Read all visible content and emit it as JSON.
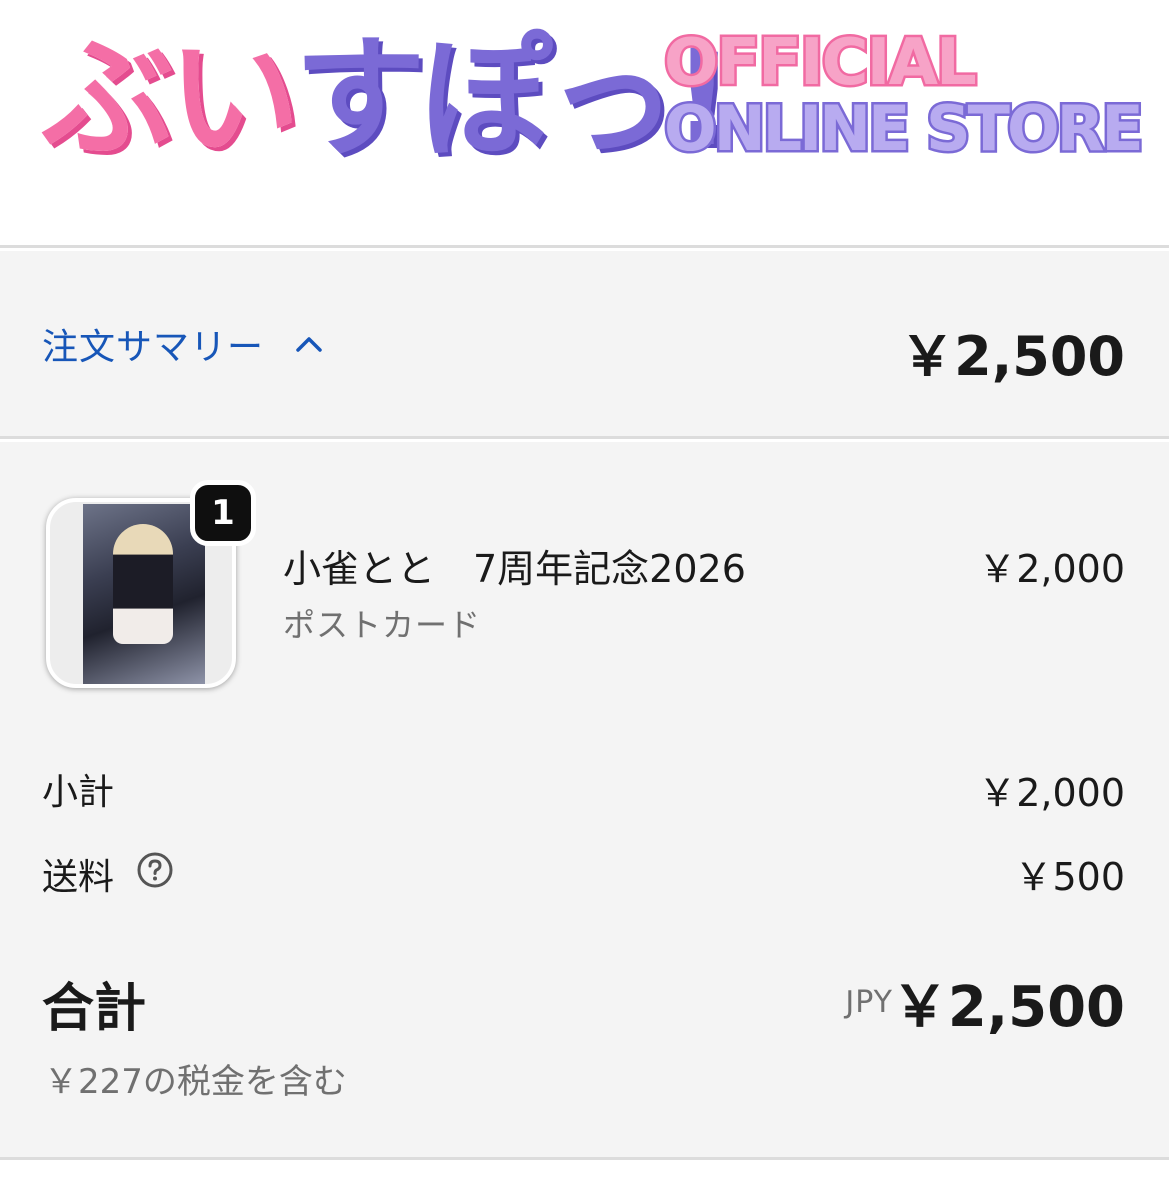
{
  "brand": {
    "logo_jp_pink": "ぶい",
    "logo_jp_purple": "すぽ",
    "logo_jp_accent": "っ!",
    "logo_en_line1": "OFFICIAL",
    "logo_en_line2": "ONLINE STORE",
    "colors": {
      "pink": "#f46ea6",
      "purple": "#7b6ad6"
    }
  },
  "summary": {
    "toggle_label": "注文サマリー",
    "toggle_icon": "chevron-up-icon",
    "total": "￥2,500",
    "link_color": "#1756b8"
  },
  "line_items": [
    {
      "quantity": "1",
      "title": "小雀とと　7周年記念2026",
      "variant": "ポストカード",
      "price": "￥2,000"
    }
  ],
  "costs": {
    "subtotal_label": "小計",
    "subtotal_value": "￥2,000",
    "shipping_label": "送料",
    "shipping_help_icon": "question-circle-icon",
    "shipping_value": "￥500",
    "total_label": "合計",
    "total_currency": "JPY",
    "total_value": "￥2,500",
    "tax_note": "￥227の税金を含む"
  }
}
